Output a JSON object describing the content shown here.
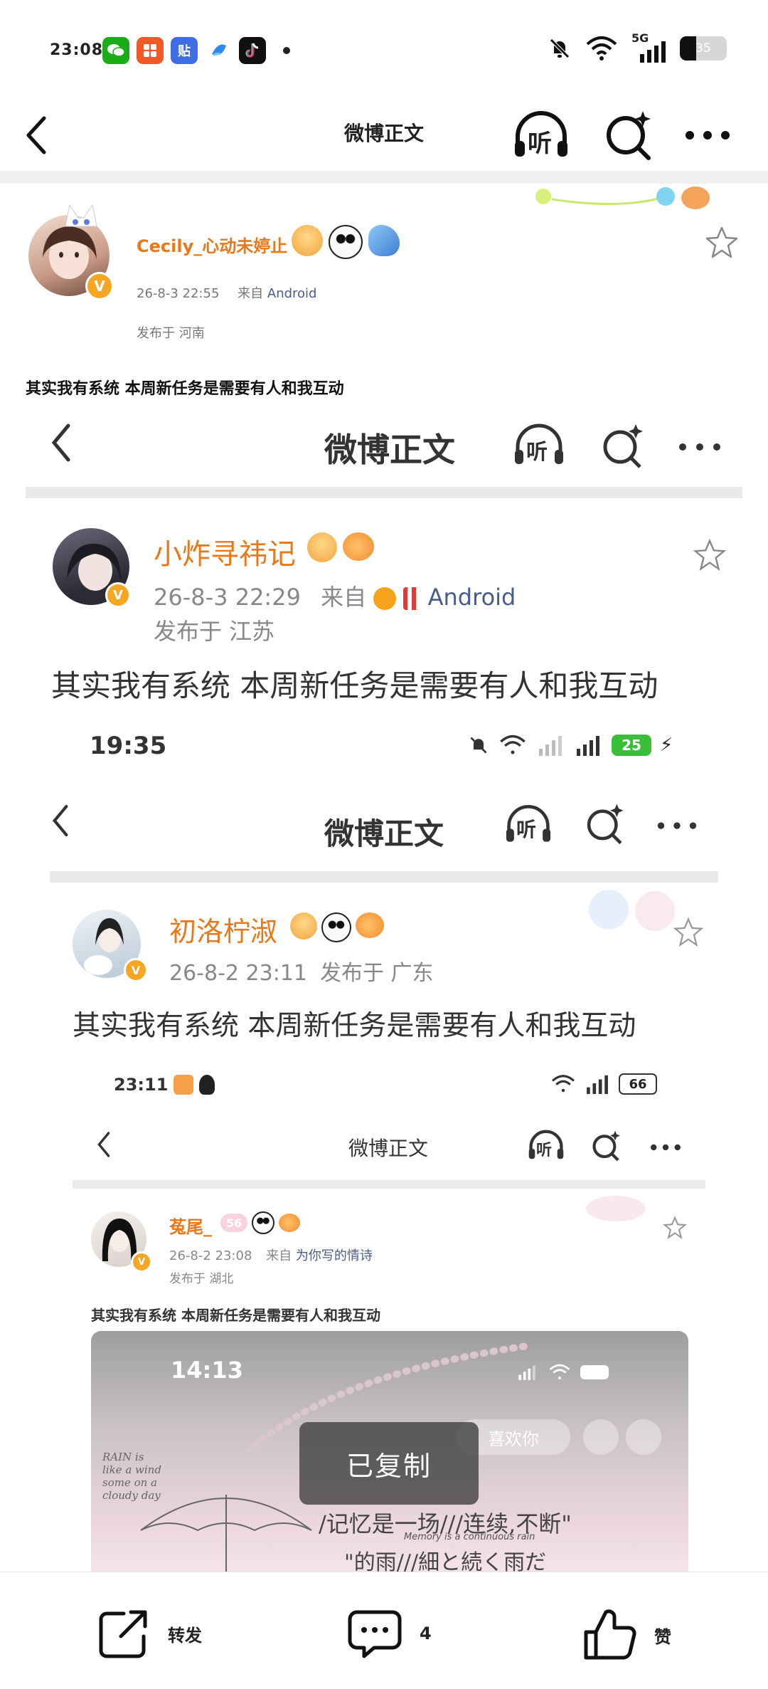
{
  "status_bar": {
    "time": "23:08",
    "network": "5G",
    "battery_percent": 35,
    "battery_label": "35",
    "apps": [
      {
        "name": "wechat-icon",
        "color": "#1aad19"
      },
      {
        "name": "xiaohongshu-icon",
        "color": "#f05a28"
      },
      {
        "name": "tieba-icon",
        "color": "#3e6ee6",
        "glyph": "贴"
      },
      {
        "name": "browser-icon",
        "color": "#2f8af0"
      },
      {
        "name": "douyin-icon",
        "color": "#111111"
      }
    ]
  },
  "header": {
    "title": "微博正文",
    "listen_label": "听"
  },
  "post": {
    "username": "Cecily_心动未婷止",
    "time": "26-8-3 22:55",
    "source_prefix": "来自",
    "source": "Android",
    "location": "发布于 河南",
    "text": "其实我有系统 本周新任务是需要有人和我互动"
  },
  "nested1": {
    "header_title": "微博正文",
    "listen_label": "听",
    "username": "小炸寻祎记",
    "time": "26-8-3 22:29",
    "source_prefix": "来自",
    "source": "Android",
    "location": "发布于 江苏",
    "text": "其实我有系统 本周新任务是需要有人和我互动"
  },
  "nested2": {
    "status_time": "19:35",
    "battery": "25",
    "header_title": "微博正文",
    "listen_label": "听",
    "username": "初洛柠淑",
    "time": "26-8-2 23:11",
    "location": "发布于 广东",
    "text": "其实我有系统 本周新任务是需要有人和我互动"
  },
  "nested3": {
    "status_time": "23:11",
    "battery": "66",
    "header_title": "微博正文",
    "listen_label": "听",
    "username": "菟尾_",
    "badge_level": "56",
    "time": "26-8-2 23:08",
    "source_prefix": "来自",
    "source": "为你写的情诗",
    "location": "发布于 湖北",
    "text": "其实我有系统 本周新任务是需要有人和我互动"
  },
  "image": {
    "time": "14:13",
    "like_label": "喜欢你",
    "poem_en": "RAIN is like a wind some on a cloudy day",
    "line1": "/记忆是一场///连续,不断\"",
    "line1_en": "Memory is a continuous rain",
    "line2": "\"的雨///細と続く雨だ"
  },
  "toast": "已复制",
  "actions": {
    "repost": "转发",
    "comment_count": "4",
    "like": "赞"
  }
}
